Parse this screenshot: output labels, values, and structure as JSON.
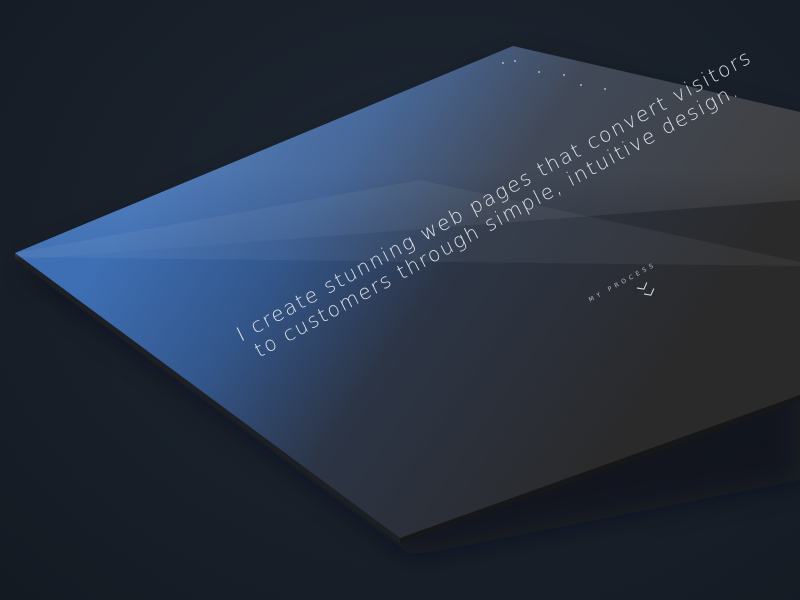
{
  "hero": {
    "headline_line_1": "I create stunning web pages that convert visitors",
    "headline_line_2": "to customers through simple, intuitive design."
  },
  "cta": {
    "label": "MY PROCESS",
    "icon": "chevron-down-icon"
  },
  "nav": {
    "icon": "nav-dot-icon"
  },
  "colors": {
    "background": "#19202a",
    "card_top_left": "#3d6db2",
    "card_bottom_right": "#2b2b2b",
    "card_edge": "#1b1c1e",
    "text": "#e6ebf2"
  }
}
